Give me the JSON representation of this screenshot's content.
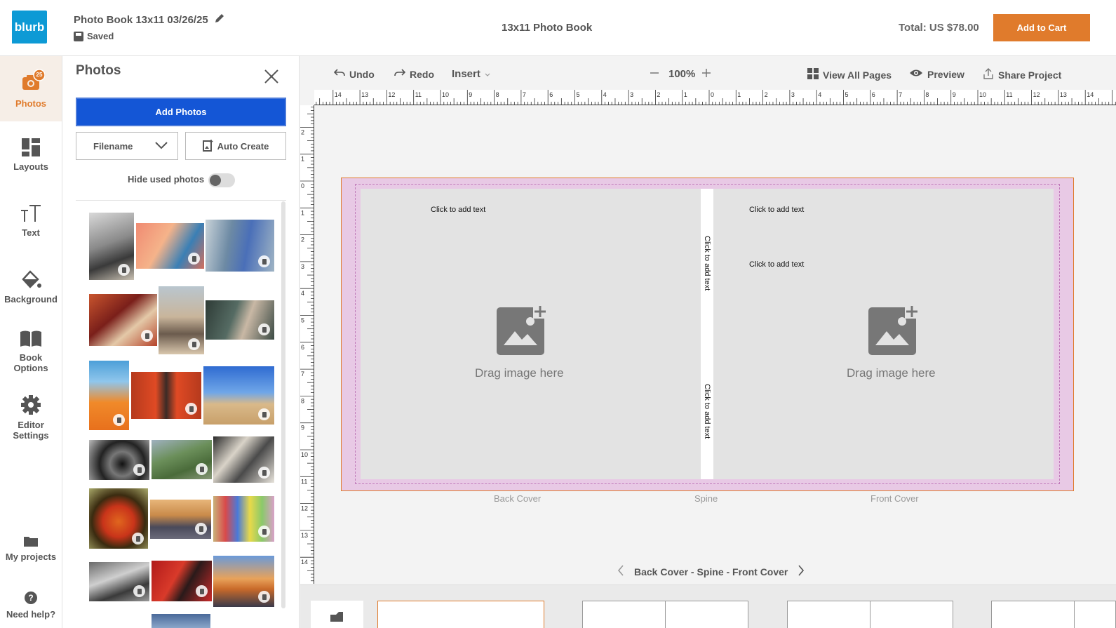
{
  "header": {
    "logo_text": "blurb",
    "project_title": "Photo Book 13x11 03/26/25",
    "saved_label": "Saved",
    "book_type": "13x11 Photo Book",
    "total": "Total: US $78.00",
    "add_to_cart": "Add to Cart",
    "accent_color": "#e07b2c",
    "brand_color": "#0d9ad5"
  },
  "leftnav": {
    "photos_badge": "25",
    "items": [
      {
        "label": "Photos",
        "icon": "camera-icon"
      },
      {
        "label": "Layouts",
        "icon": "layouts-icon"
      },
      {
        "label": "Text",
        "icon": "text-icon"
      },
      {
        "label": "Background",
        "icon": "paint-bucket-icon"
      },
      {
        "label": "Book Options",
        "icon": "book-icon"
      },
      {
        "label": "Editor Settings",
        "icon": "gear-icon"
      },
      {
        "label": "My projects",
        "icon": "folder-icon"
      },
      {
        "label": "Need help?",
        "icon": "help-icon"
      }
    ]
  },
  "panel": {
    "title": "Photos",
    "add_photos": "Add Photos",
    "sort_value": "Filename",
    "auto_create": "Auto Create",
    "hide_used": "Hide used photos"
  },
  "toolbar": {
    "undo": "Undo",
    "redo": "Redo",
    "insert": "Insert",
    "zoom": "100%",
    "view_all": "View All Pages",
    "preview": "Preview",
    "share": "Share Project"
  },
  "canvas": {
    "click_to_add_text": "Click to add text",
    "drag_image": "Drag image here",
    "back_cover": "Back Cover",
    "spine": "Spine",
    "front_cover": "Front Cover",
    "page_nav": "Back Cover - Spine - Front Cover"
  }
}
